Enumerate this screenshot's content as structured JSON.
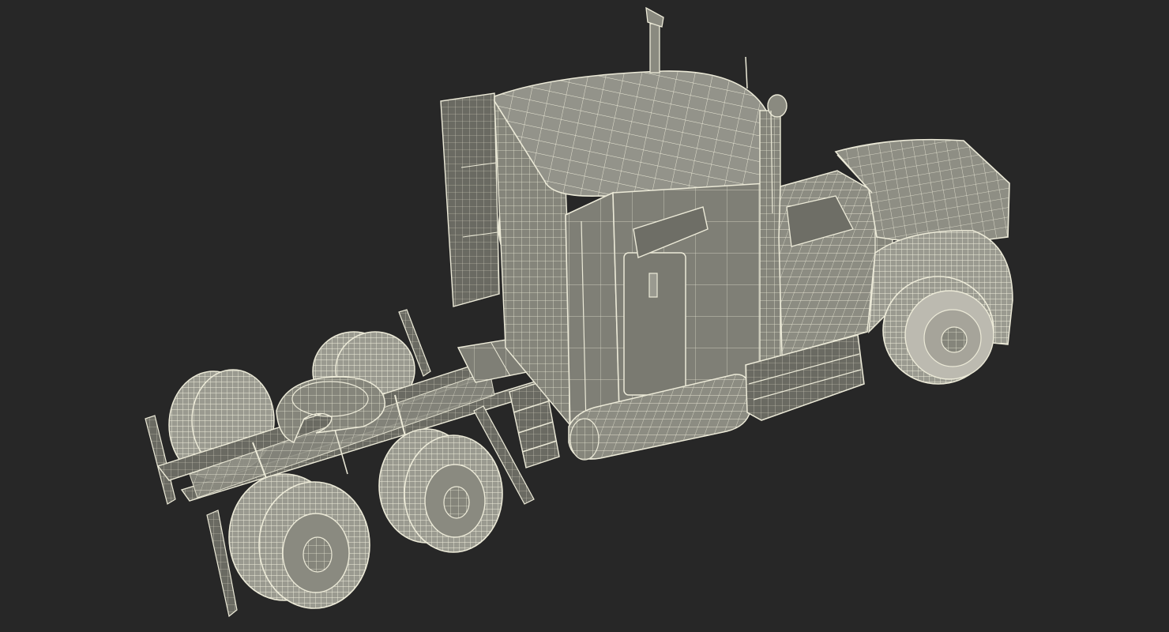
{
  "scene": {
    "background_color": "#272727",
    "model_fill_color": "#8a8a80",
    "model_dark_color": "#5e5e56",
    "wire_color": "#ecead8"
  }
}
